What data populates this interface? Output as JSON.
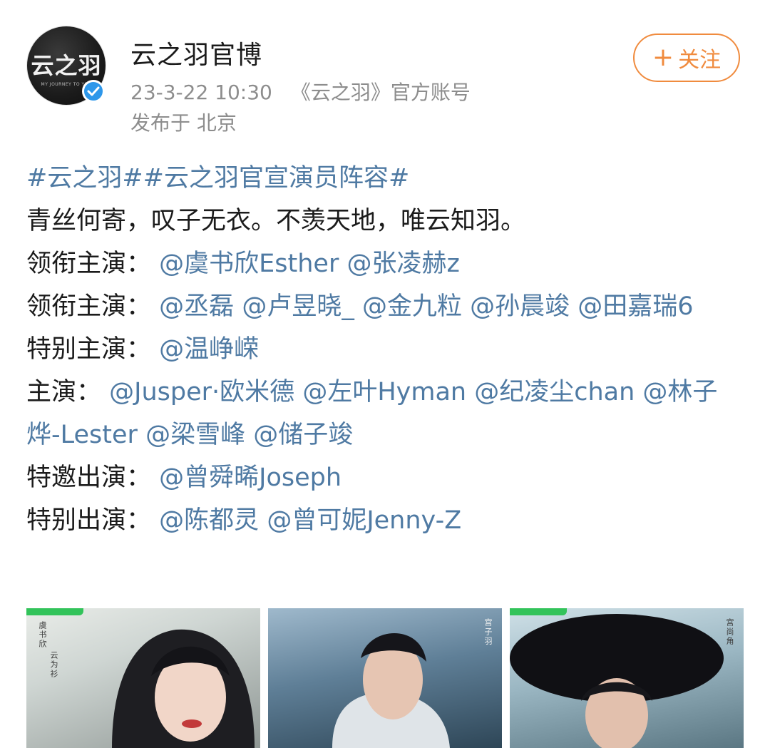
{
  "header": {
    "avatar_text": "云之羽",
    "avatar_subtext": "MY JOURNEY TO YOU",
    "account_name": "云之羽官博",
    "timestamp": "23-3-22 10:30",
    "account_type": "《云之羽》官方账号",
    "location": "发布于 北京",
    "follow_label": "关注",
    "follow_plus": "+"
  },
  "post": {
    "hashtags": [
      "#云之羽#",
      "#云之羽官宣演员阵容#"
    ],
    "tagline": "青丝何寄，叹子无衣。不羡天地，唯云知羽。",
    "rows": [
      {
        "label": "领衔主演：",
        "mentions": [
          "@虞书欣Esther",
          "@张凌赫z"
        ]
      },
      {
        "label": "领衔主演：",
        "mentions": [
          "@丞磊",
          "@卢昱晓_",
          "@金九粒",
          "@孙晨竣",
          "@田嘉瑞6"
        ]
      },
      {
        "label": "特别主演：",
        "mentions": [
          "@温峥嵘"
        ]
      },
      {
        "label": "主演：",
        "mentions": [
          "@Jusper·欧米德",
          "@左叶Hyman",
          "@纪凌尘chan",
          "@林子烨-Lester",
          "@梁雪峰",
          "@储子竣"
        ]
      },
      {
        "label": "特邀出演：",
        "mentions": [
          "@曾舜晞Joseph"
        ]
      },
      {
        "label": "特别出演：",
        "mentions": [
          "@陈都灵",
          "@曾可妮Jenny-Z"
        ]
      }
    ]
  },
  "images": [
    {
      "caption_top": "虞书欣",
      "caption_role": "云为衫"
    },
    {
      "caption_top": "",
      "caption_role": "宫子羽"
    },
    {
      "caption_top": "",
      "caption_role": "宫尚角"
    }
  ],
  "colors": {
    "link": "#4f7aa3",
    "follow": "#f08b3e",
    "verified": "#2d97ea",
    "tag_green": "#32c35a"
  }
}
